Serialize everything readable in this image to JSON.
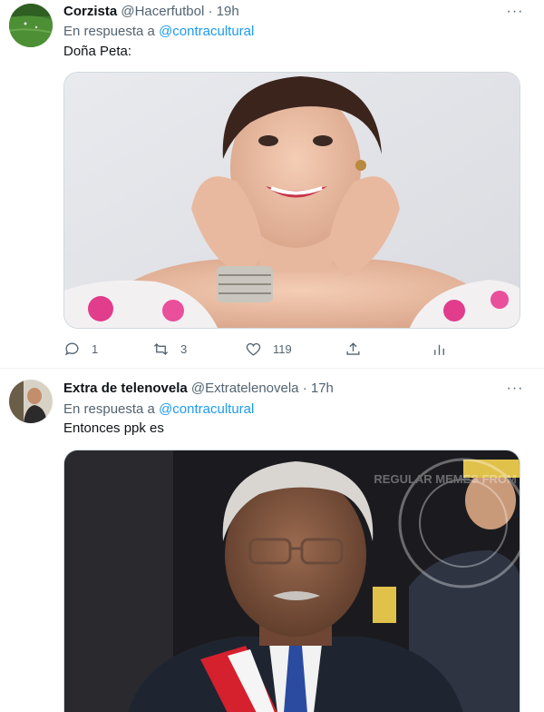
{
  "tweets": [
    {
      "display_name": "Corzista",
      "handle": "@Hacerfutbol",
      "separator": "·",
      "time": "19h",
      "reply_prefix": "En respuesta a",
      "reply_to": "@contracultural",
      "text": "Doña Peta:",
      "media_description": "photo",
      "actions": {
        "replies": "1",
        "retweets": "3",
        "likes": "119"
      }
    },
    {
      "display_name": "Extra de telenovela",
      "handle": "@Extratelenovela",
      "separator": "·",
      "time": "17h",
      "reply_prefix": "En respuesta a",
      "reply_to": "@contracultural",
      "text": "Entonces ppk es",
      "watermark_text": "REGULAR MEMES FROM PERU",
      "media_description": "photo"
    }
  ],
  "more_icon_glyph": "···",
  "colors": {
    "text_primary": "#0f1419",
    "text_secondary": "#536471",
    "link": "#1d9bf0",
    "divider": "#eff3f4"
  }
}
